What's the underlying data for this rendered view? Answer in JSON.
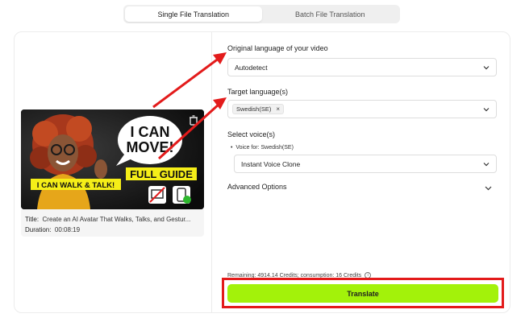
{
  "tabs": [
    {
      "label": "Single File Translation",
      "active": true
    },
    {
      "label": "Batch File Translation",
      "active": false
    }
  ],
  "video": {
    "thumbnail_text": {
      "headline_line1": "I CAN",
      "headline_line2": "MOVE!",
      "guide": "FULL GUIDE",
      "banner": "I CAN WALK & TALK!"
    },
    "title_label": "Title:",
    "title_value": "Create an AI Avatar That Walks, Talks, and Gestur...",
    "duration_label": "Duration:",
    "duration_value": "00:08:19"
  },
  "form": {
    "original_language": {
      "label": "Original language of your video",
      "value": "Autodetect"
    },
    "target_language": {
      "label": "Target language(s)",
      "tag": "Swedish(SE)",
      "tag_remove": "×"
    },
    "voice": {
      "label": "Select voice(s)",
      "voice_for": "Voice for: Swedish(SE)",
      "value": "Instant Voice Clone"
    },
    "advanced_label": "Advanced Options"
  },
  "credits_text": "Remaining: 4914.14 Credits; consumption: 16 Credits",
  "info_icon": "i",
  "translate_label": "Translate",
  "colors": {
    "accent": "#a3f20a",
    "annotation": "#e31b1b"
  }
}
